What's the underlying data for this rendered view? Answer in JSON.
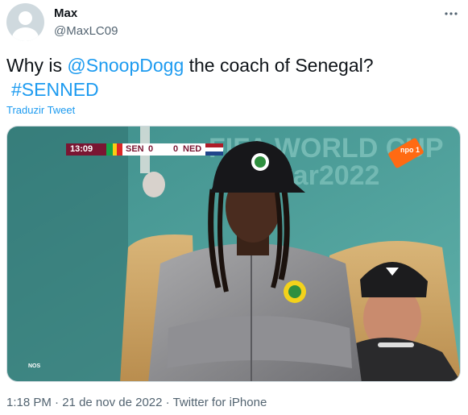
{
  "author": {
    "display_name": "Max",
    "handle": "@MaxLC09"
  },
  "menu_icon": "more-horizontal-icon",
  "tweet": {
    "text_prefix": "Why is ",
    "mention": "@SnoopDogg",
    "text_suffix": " the coach of Senegal?",
    "hashtag": "#SENNED"
  },
  "translate_link": "Traduzir Tweet",
  "media": {
    "scoreboard": {
      "time": "13:09",
      "home": "SEN",
      "home_score": "0",
      "away_score": "0",
      "away": "NED"
    },
    "background_text": "FIFA WORLD CUP Qatar2022",
    "channel_badge": "npo 1",
    "broadcaster": "NOS",
    "colors": {
      "scoreboard_maroon": "#7a1532",
      "pitch_teal": "#4e9f9a"
    }
  },
  "meta": {
    "time": "1:18 PM",
    "date": "21 de nov de 2022",
    "client": "Twitter for iPhone",
    "separator": " · "
  }
}
